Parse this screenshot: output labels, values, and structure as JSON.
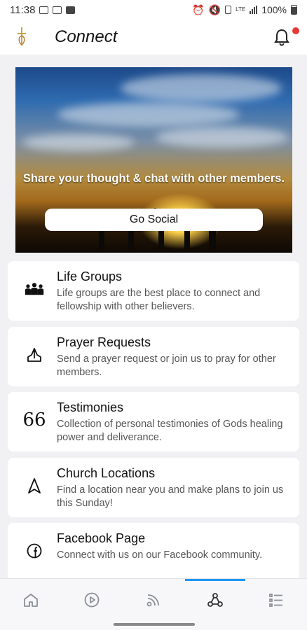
{
  "status": {
    "time": "11:38",
    "battery": "100%",
    "network": "LTE"
  },
  "header": {
    "title": "Connect"
  },
  "banner": {
    "caption": "Share your thought & chat with other members.",
    "button_label": "Go Social"
  },
  "cards": [
    {
      "title": "Life Groups",
      "description": "Life groups are the best place to connect and fellowship with other believers.",
      "icon": "people-group-icon"
    },
    {
      "title": "Prayer Requests",
      "description": "Send a prayer request or join us to pray for other members.",
      "icon": "praying-hands-icon"
    },
    {
      "title": "Testimonies",
      "description": "Collection of personal testimonies of Gods healing power and deliverance.",
      "icon": "quote-icon"
    },
    {
      "title": "Church Locations",
      "description": "Find a location near you and make plans to join us this Sunday!",
      "icon": "location-pointer-icon"
    },
    {
      "title": "Facebook Page",
      "description": "Connect with us on our Facebook community.",
      "icon": "facebook-icon"
    }
  ],
  "bottom_nav": {
    "items": [
      "home-icon",
      "play-icon",
      "podcast-icon",
      "connect-icon",
      "list-icon"
    ],
    "active": "connect-icon",
    "accent_color": "#2196f3"
  },
  "notification_dot_color": "#e53935"
}
